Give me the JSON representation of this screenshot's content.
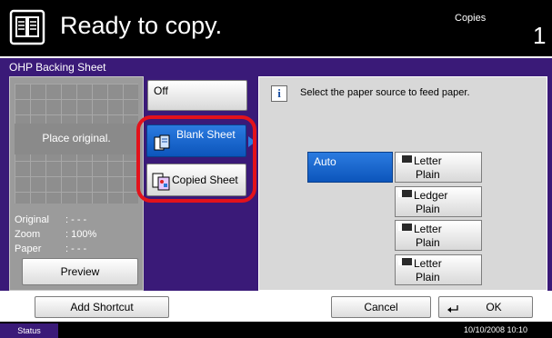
{
  "header": {
    "title": "Ready to copy.",
    "copies_label": "Copies",
    "copies_value": "1"
  },
  "panel": {
    "title": "OHP Backing Sheet"
  },
  "preview": {
    "place_text": "Place original.",
    "original_label": "Original",
    "original_value": ": - - -",
    "zoom_label": "Zoom",
    "zoom_value": ": 100%",
    "paper_label": "Paper",
    "paper_value": ": - - -",
    "preview_button": "Preview"
  },
  "options": {
    "off": "Off",
    "blank_sheet": "Blank Sheet",
    "copied_sheet": "Copied Sheet"
  },
  "message": "Select the paper source to feed paper.",
  "sources": {
    "auto": "Auto",
    "trays": [
      {
        "size": "Letter",
        "type": "Plain"
      },
      {
        "size": "Ledger",
        "type": "Plain"
      },
      {
        "size": "Letter",
        "type": "Plain"
      },
      {
        "size": "Letter",
        "type": "Plain"
      }
    ]
  },
  "bottom": {
    "add_shortcut": "Add Shortcut",
    "cancel": "Cancel",
    "ok": "OK"
  },
  "status": {
    "label": "Status",
    "datetime": "10/10/2008   10:10"
  }
}
